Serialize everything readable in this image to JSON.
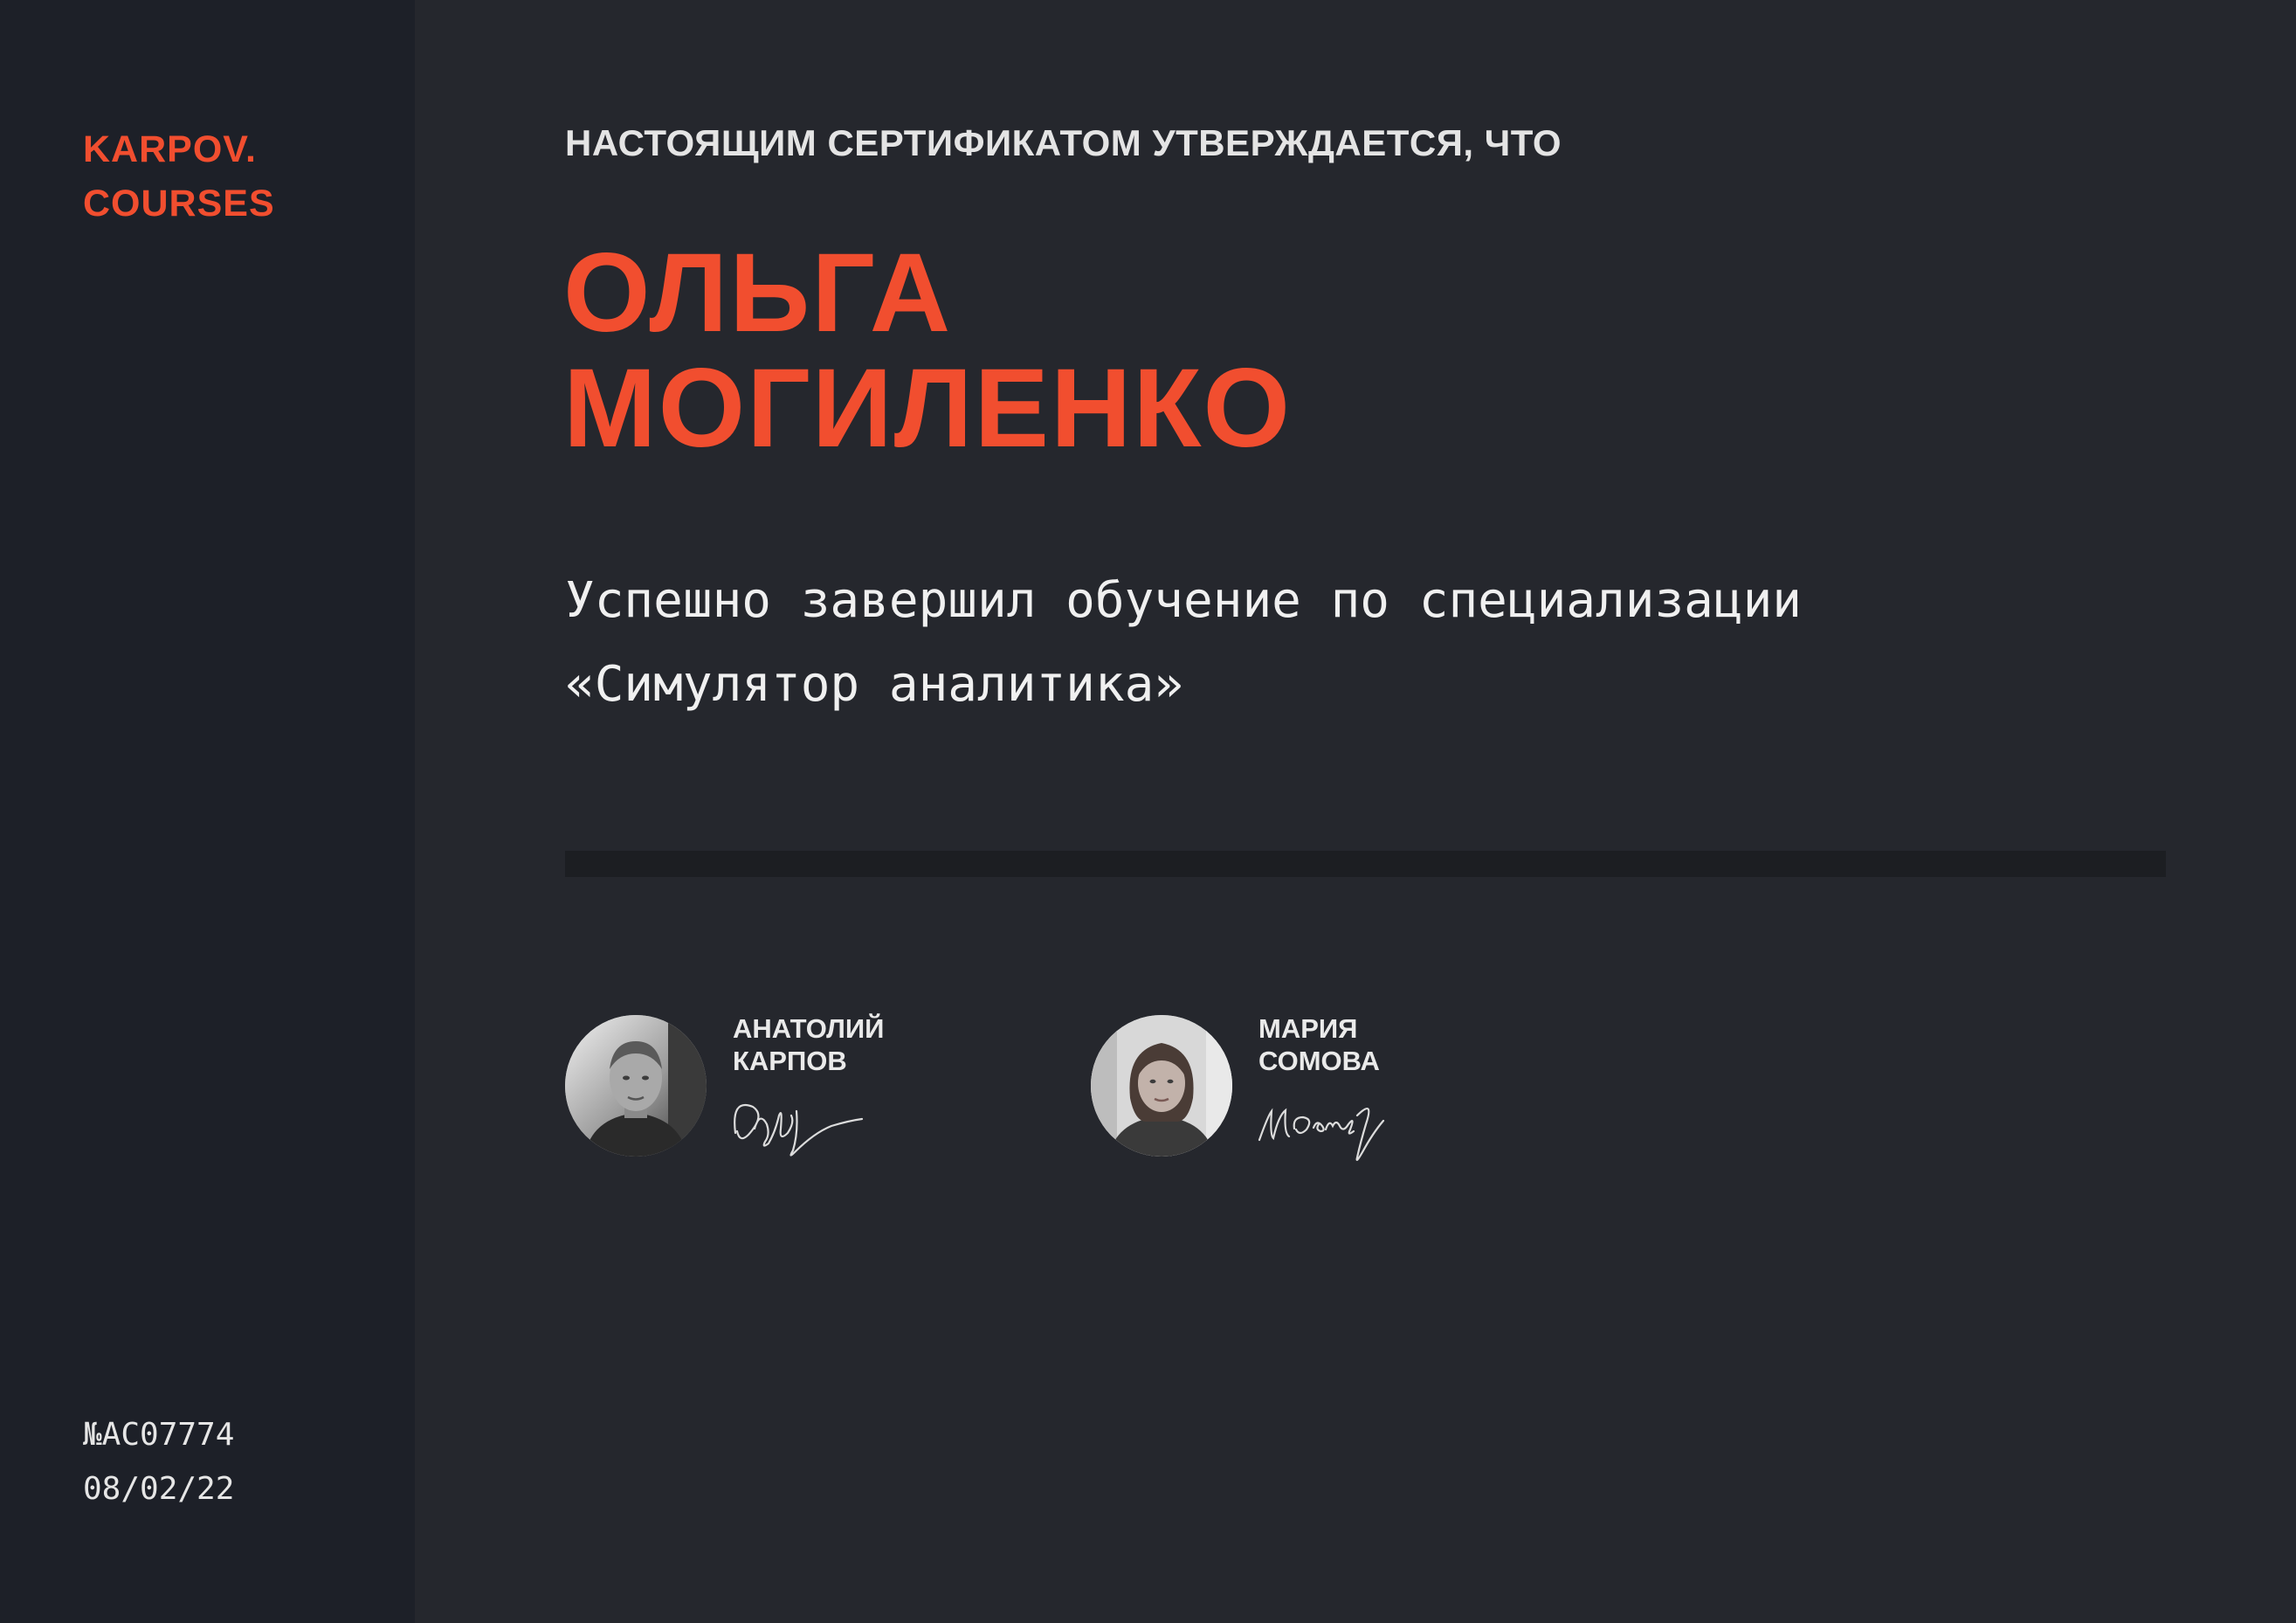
{
  "brand": {
    "line1": "KARPOV.",
    "line2": "COURSES",
    "color": "#f14e2f"
  },
  "certificate": {
    "number": "№AC07774",
    "date": "08/02/22"
  },
  "header": "НАСТОЯЩИМ СЕРТИФИКАТОМ УТВЕРЖДАЕТСЯ, ЧТО",
  "recipient": {
    "first_name": "ОЛЬГА",
    "last_name": "МОГИЛЕНКО"
  },
  "statement": {
    "line1": "Успешно завершил обучение по специализации",
    "line2": "«Симулятор аналитика»"
  },
  "signers": [
    {
      "first_name": "АНАТОЛИЙ",
      "last_name": "КАРПОВ",
      "icon": "avatar-photo"
    },
    {
      "first_name": "МАРИЯ",
      "last_name": "СОМОВА",
      "icon": "avatar-photo"
    }
  ],
  "colors": {
    "background": "#25272d",
    "sidebar": "#1d2028",
    "accent": "#f14e2f"
  }
}
